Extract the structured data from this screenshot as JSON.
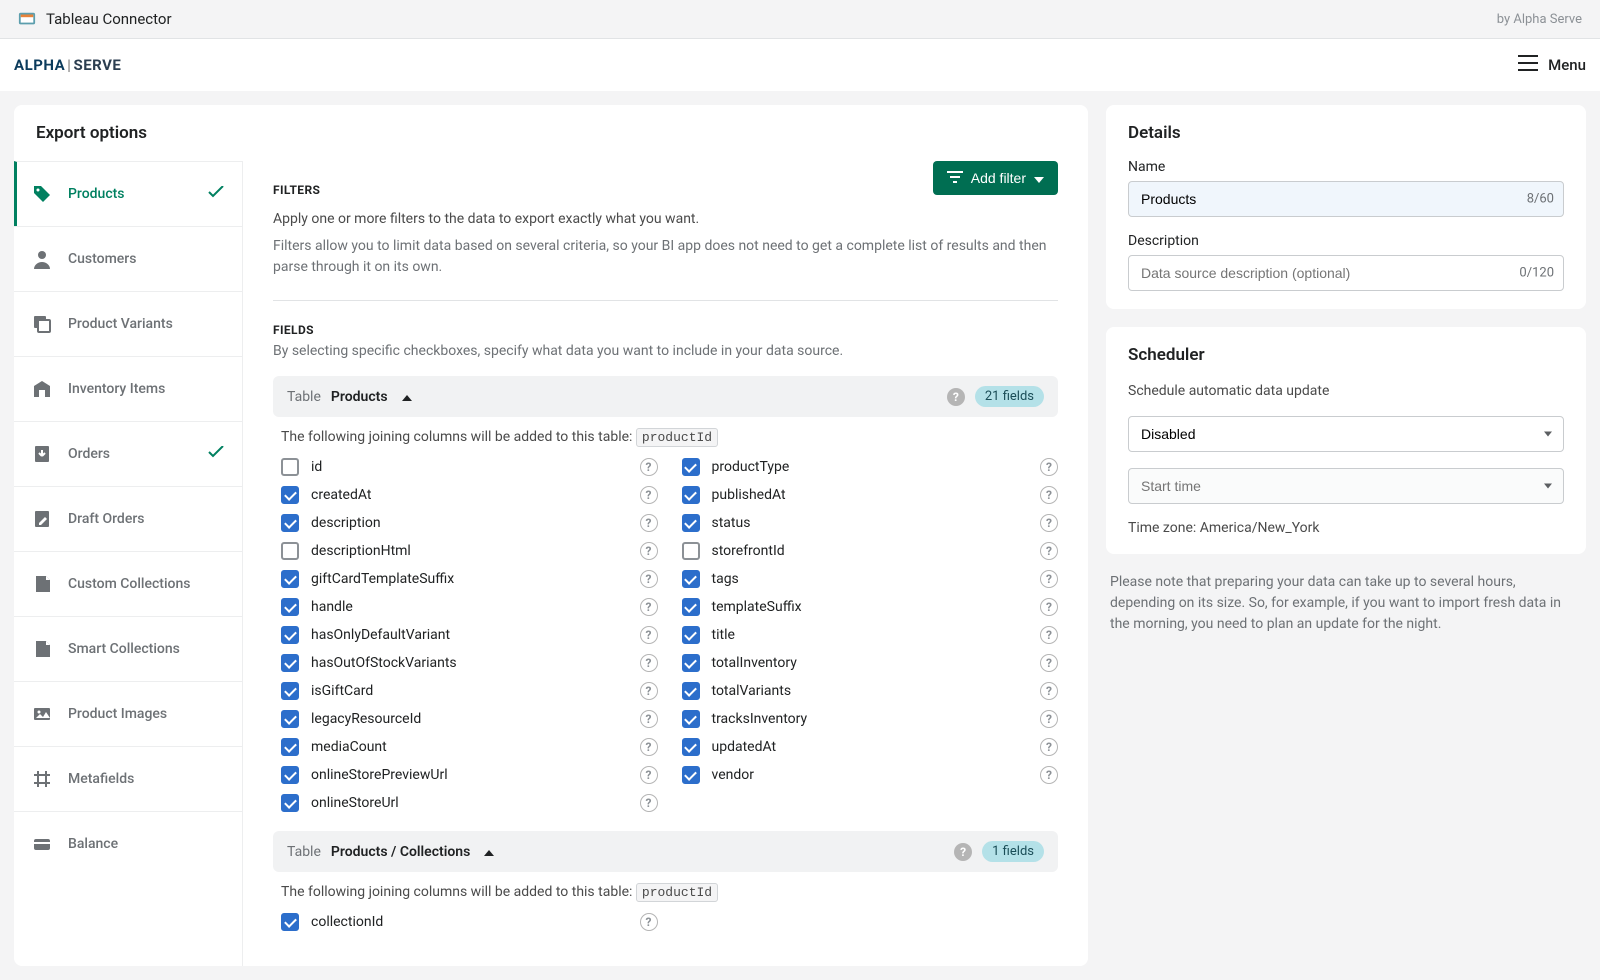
{
  "topbar": {
    "title": "Tableau Connector",
    "byline": "by Alpha Serve"
  },
  "header": {
    "logo_alpha": "ALPHA",
    "logo_serve": "SERVE",
    "menu": "Menu"
  },
  "main_title": "Export options",
  "sidebar": {
    "items": [
      {
        "label": "Products",
        "active": true,
        "checked": true,
        "icon": "tag"
      },
      {
        "label": "Customers",
        "icon": "person"
      },
      {
        "label": "Product Variants",
        "icon": "variant"
      },
      {
        "label": "Inventory Items",
        "icon": "inventory"
      },
      {
        "label": "Orders",
        "checked": true,
        "icon": "orders"
      },
      {
        "label": "Draft Orders",
        "icon": "draft"
      },
      {
        "label": "Custom Collections",
        "icon": "collection"
      },
      {
        "label": "Smart Collections",
        "icon": "collection"
      },
      {
        "label": "Product Images",
        "icon": "images"
      },
      {
        "label": "Metafields",
        "icon": "hash"
      },
      {
        "label": "Balance",
        "icon": "balance"
      }
    ]
  },
  "filters": {
    "label": "FILTERS",
    "add": "Add filter",
    "desc1": "Apply one or more filters to the data to export exactly what you want.",
    "desc2": "Filters allow you to limit data based on several criteria, so your BI app does not need to get a complete list of results and then parse through it on its own."
  },
  "fields": {
    "label": "FIELDS",
    "desc": "By selecting specific checkboxes, specify what data you want to include in your data source.",
    "table_word": "Table",
    "tables": [
      {
        "name": "Products",
        "badge": "21 fields",
        "join_text": "The following joining columns will be added to this table:",
        "join_col": "productId",
        "left": [
          {
            "label": "id",
            "checked": false
          },
          {
            "label": "createdAt",
            "checked": true
          },
          {
            "label": "description",
            "checked": true
          },
          {
            "label": "descriptionHtml",
            "checked": false
          },
          {
            "label": "giftCardTemplateSuffix",
            "checked": true
          },
          {
            "label": "handle",
            "checked": true
          },
          {
            "label": "hasOnlyDefaultVariant",
            "checked": true
          },
          {
            "label": "hasOutOfStockVariants",
            "checked": true
          },
          {
            "label": "isGiftCard",
            "checked": true
          },
          {
            "label": "legacyResourceId",
            "checked": true
          },
          {
            "label": "mediaCount",
            "checked": true
          },
          {
            "label": "onlineStorePreviewUrl",
            "checked": true
          },
          {
            "label": "onlineStoreUrl",
            "checked": true
          }
        ],
        "right": [
          {
            "label": "productType",
            "checked": true
          },
          {
            "label": "publishedAt",
            "checked": true
          },
          {
            "label": "status",
            "checked": true
          },
          {
            "label": "storefrontId",
            "checked": false
          },
          {
            "label": "tags",
            "checked": true
          },
          {
            "label": "templateSuffix",
            "checked": true
          },
          {
            "label": "title",
            "checked": true
          },
          {
            "label": "totalInventory",
            "checked": true
          },
          {
            "label": "totalVariants",
            "checked": true
          },
          {
            "label": "tracksInventory",
            "checked": true
          },
          {
            "label": "updatedAt",
            "checked": true
          },
          {
            "label": "vendor",
            "checked": true
          }
        ]
      },
      {
        "name": "Products / Collections",
        "badge": "1 fields",
        "join_text": "The following joining columns will be added to this table:",
        "join_col": "productId",
        "left": [
          {
            "label": "collectionId",
            "checked": true
          }
        ],
        "right": []
      }
    ]
  },
  "details": {
    "title": "Details",
    "name_label": "Name",
    "name_value": "Products",
    "name_count": "8/60",
    "desc_label": "Description",
    "desc_placeholder": "Data source description (optional)",
    "desc_count": "0/120"
  },
  "scheduler": {
    "title": "Scheduler",
    "desc": "Schedule automatic data update",
    "mode": "Disabled",
    "start_placeholder": "Start time",
    "tz": "Time zone: America/New_York",
    "note": "Please note that preparing your data can take up to several hours, depending on its size. So, for example, if you want to import fresh data in the morning, you need to plan an update for the night."
  }
}
